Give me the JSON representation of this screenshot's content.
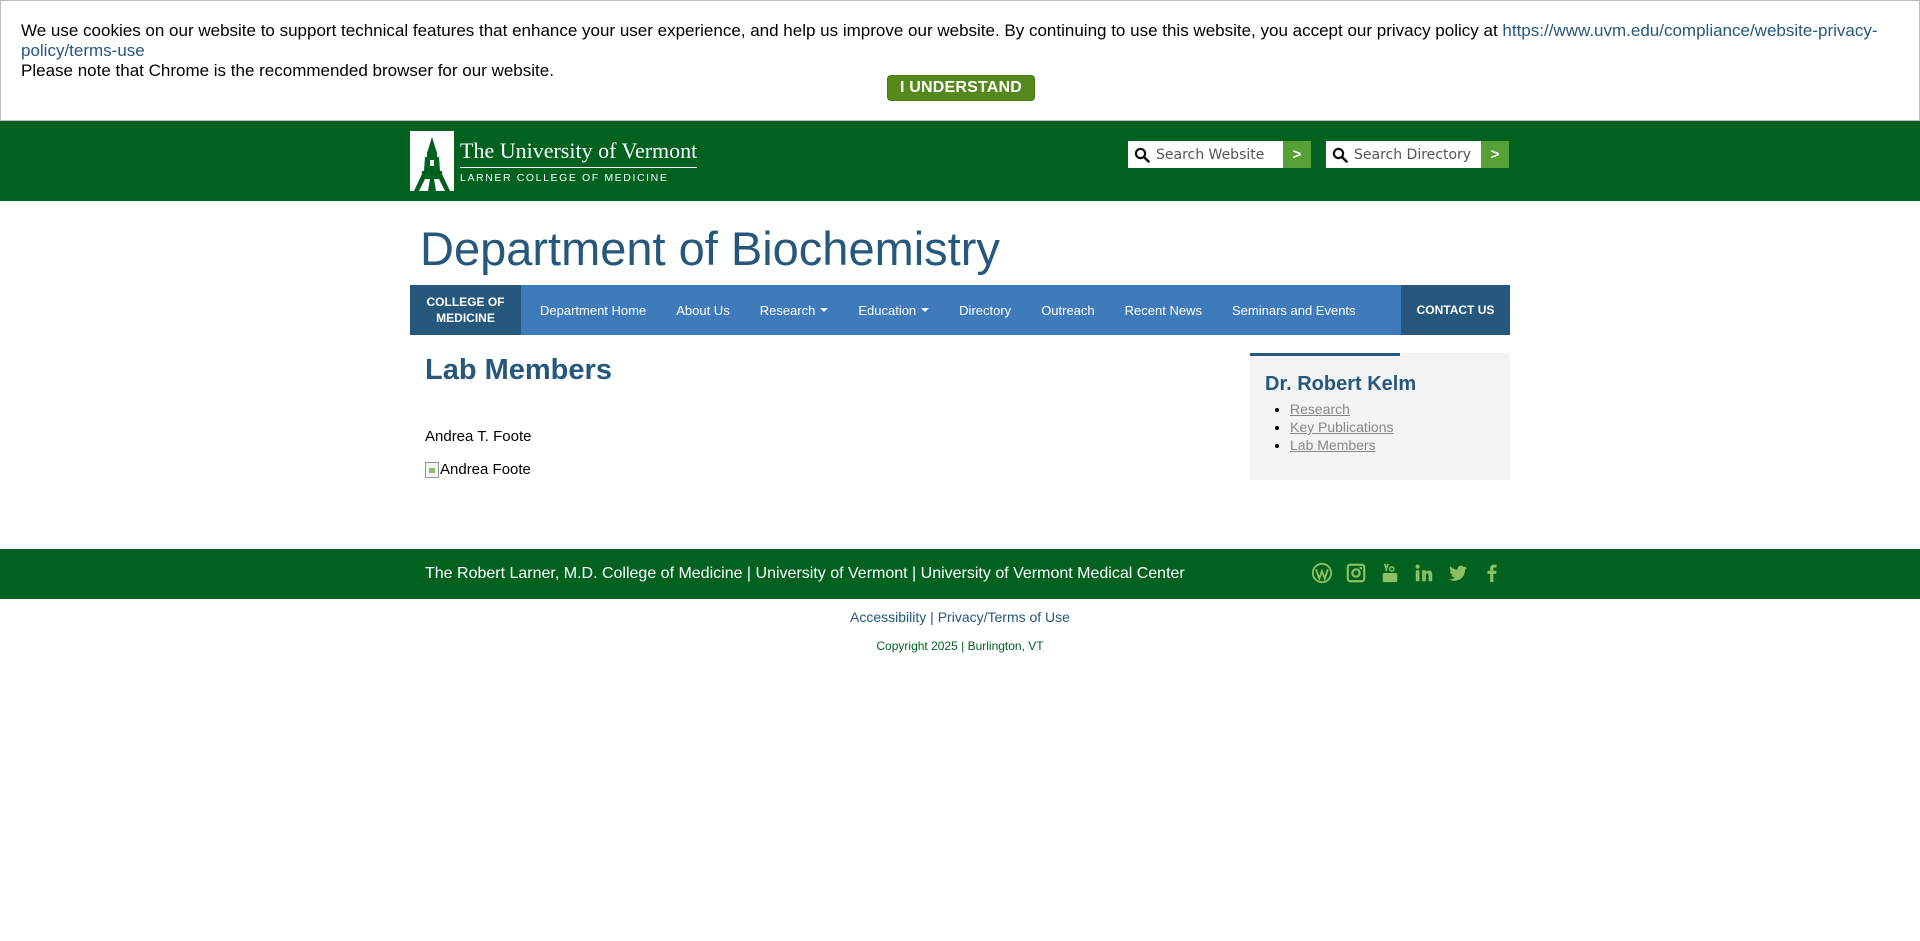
{
  "cookie_banner": {
    "text": "We use cookies on our website to support technical features that enhance your user experience, and help us improve our website. By continuing to use this website, you accept our privacy policy at ",
    "link": "https://www.uvm.edu/compliance/website-privacy-policy/terms-use",
    "note": "Please note that Chrome is the recommended browser for our website.",
    "button_label": "I UNDERSTAND"
  },
  "header": {
    "logo_line1": "The University of Vermont",
    "logo_line2": "LARNER COLLEGE OF MEDICINE",
    "search_website_placeholder": "Search Website",
    "search_directory_placeholder": "Search Directory",
    "go_label": ">"
  },
  "department_title": "Department of Biochemistry",
  "nav": {
    "college_label": "COLLEGE OF MEDICINE",
    "items": [
      {
        "label": "Department Home",
        "dropdown": false
      },
      {
        "label": "About Us",
        "dropdown": false
      },
      {
        "label": "Research",
        "dropdown": true
      },
      {
        "label": "Education",
        "dropdown": true
      },
      {
        "label": "Directory",
        "dropdown": false
      },
      {
        "label": "Outreach",
        "dropdown": false
      },
      {
        "label": "Recent News",
        "dropdown": false
      },
      {
        "label": "Seminars and Events",
        "dropdown": false
      }
    ],
    "contact_label": "CONTACT US"
  },
  "main": {
    "heading": "Lab Members",
    "member_name": "Andrea T. Foote",
    "member_image_alt": "Andrea Foote"
  },
  "sidebar": {
    "title": "Dr. Robert Kelm",
    "links": [
      "Research",
      "Key Publications",
      "Lab Members "
    ]
  },
  "footer": {
    "text": "The Robert Larner, M.D. College of Medicine | University of Vermont | University of Vermont Medical Center",
    "social_icons": [
      "wordpress-icon",
      "instagram-icon",
      "youtube-icon",
      "linkedin-icon",
      "twitter-icon",
      "facebook-icon"
    ],
    "accessibility_label": "Accessibility",
    "privacy_label": "Privacy/Terms of Use",
    "separator": " | ",
    "copyright": "Copyright 2025 | Burlington, VT"
  },
  "colors": {
    "uvm_green": "#01611f",
    "accent_green": "#55891c",
    "nav_blue": "#3f7bbb",
    "dark_blue": "#26577d",
    "social_green": "#8dc063"
  }
}
